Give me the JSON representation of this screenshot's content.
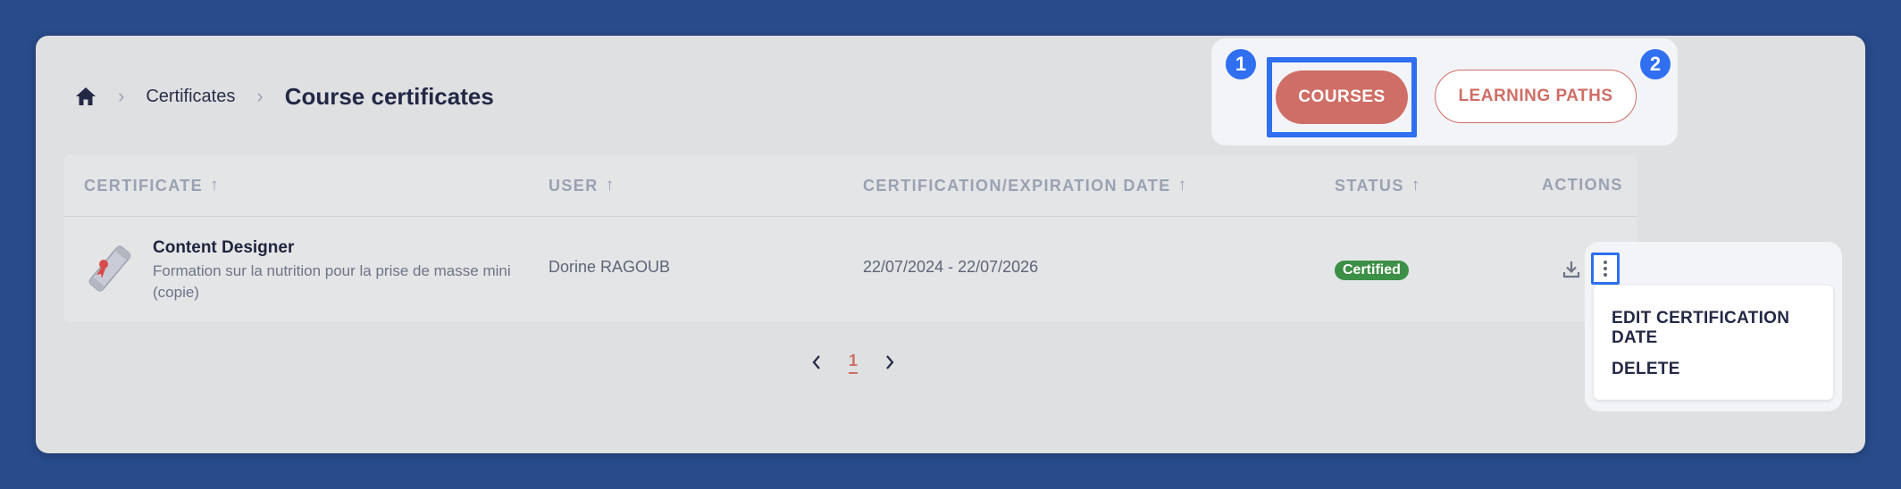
{
  "breadcrumb": {
    "home_icon": "home-icon",
    "items": [
      "Certificates",
      "Course certificates"
    ]
  },
  "tabs": {
    "courses_label": "COURSES",
    "paths_label": "LEARNING PATHS",
    "step1": "1",
    "step2": "2"
  },
  "table": {
    "headers": {
      "certificate": "CERTIFICATE",
      "user": "USER",
      "date": "CERTIFICATION/EXPIRATION DATE",
      "status": "STATUS",
      "actions": "ACTIONS"
    },
    "rows": [
      {
        "title": "Content Designer",
        "description": "Formation sur la nutrition pour la prise de masse mini (copie)",
        "user": "Dorine RAGOUB",
        "dates": "22/07/2024 - 22/07/2026",
        "status": "Certified"
      }
    ]
  },
  "dropdown": {
    "edit_label": "EDIT CERTIFICATION DATE",
    "delete_label": "DELETE"
  },
  "pagination": {
    "current": "1"
  },
  "colors": {
    "accent": "#cf6e66",
    "highlight": "#2f6ff0",
    "status_green": "#3c8f46",
    "background": "#284b8a"
  }
}
